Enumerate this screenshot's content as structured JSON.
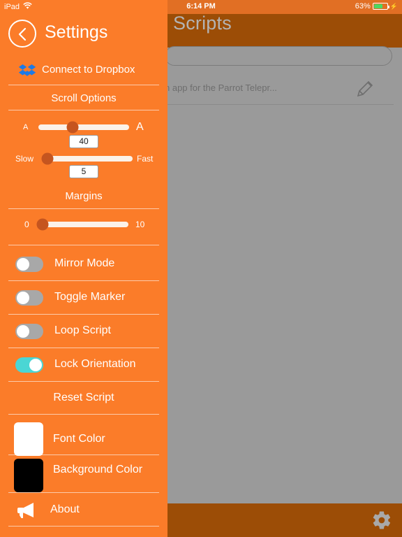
{
  "status_bar": {
    "device": "iPad",
    "wifi_icon": "wifi-icon",
    "time": "6:14 PM",
    "battery_percent": "63%",
    "battery_level": 63,
    "charging": true
  },
  "background_app": {
    "title": "Scripts",
    "search_placeholder": "",
    "search_value": "",
    "list_items": [
      {
        "text": "n app for the Parrot Telepr...",
        "edit_icon": "pencil-icon"
      }
    ],
    "bottom_bar": {
      "settings_icon": "gear-icon"
    }
  },
  "sidebar": {
    "back_icon": "chevron-left-icon",
    "title": "Settings",
    "dropbox": {
      "icon": "dropbox-icon",
      "label": "Connect to Dropbox"
    },
    "sections": {
      "scroll_options": "Scroll Options",
      "margins": "Margins"
    },
    "sliders": [
      {
        "name": "font-size",
        "left_label": "A",
        "right_label": "A",
        "value": "40",
        "percent": 38
      },
      {
        "name": "scroll-speed",
        "left_label": "Slow",
        "right_label": "Fast",
        "value": "5",
        "percent": 6
      },
      {
        "name": "margins",
        "left_label": "0",
        "right_label": "10",
        "value": "0",
        "percent": 2
      }
    ],
    "toggles": [
      {
        "label": "Mirror Mode",
        "on": false
      },
      {
        "label": "Toggle Marker",
        "on": false
      },
      {
        "label": "Loop Script",
        "on": false
      },
      {
        "label": "Lock Orientation",
        "on": true
      }
    ],
    "reset_script": "Reset Script",
    "colors": [
      {
        "label": "Font Color",
        "swatch": "#ffffff"
      },
      {
        "label": "Background Color",
        "swatch": "#000000"
      }
    ],
    "about": {
      "icon": "megaphone-icon",
      "label": "About"
    }
  },
  "theme": {
    "orange": "#fb7c29",
    "dark_orange": "#9c4d06",
    "overlay_gray": "#9a9a9a",
    "thumb": "#c5551f",
    "toggle_on": "#4ad6d4",
    "toggle_off": "#a8a8a8",
    "dropbox_blue": "#1e7ae6",
    "battery_green": "#4cd763"
  }
}
